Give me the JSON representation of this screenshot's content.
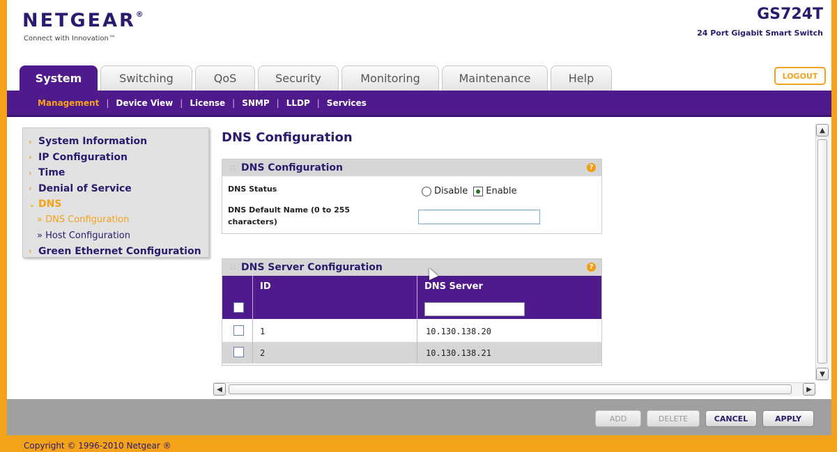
{
  "header": {
    "logo": "NETGEAR",
    "registered": "®",
    "tagline": "Connect with Innovation™",
    "model": "GS724T",
    "model_subtitle": "24 Port Gigabit Smart Switch",
    "logout": "LOGOUT"
  },
  "tabs": [
    {
      "label": "System",
      "active": true
    },
    {
      "label": "Switching"
    },
    {
      "label": "QoS"
    },
    {
      "label": "Security"
    },
    {
      "label": "Monitoring"
    },
    {
      "label": "Maintenance"
    },
    {
      "label": "Help"
    }
  ],
  "subnav": [
    {
      "label": "Management",
      "active": true
    },
    {
      "label": "Device View"
    },
    {
      "label": "License"
    },
    {
      "label": "SNMP"
    },
    {
      "label": "LLDP"
    },
    {
      "label": "Services"
    }
  ],
  "sidebar": {
    "items": [
      {
        "label": "System Information"
      },
      {
        "label": "IP Configuration"
      },
      {
        "label": "Time"
      },
      {
        "label": "Denial of Service"
      },
      {
        "label": "DNS",
        "open": true
      },
      {
        "label": "» DNS Configuration",
        "sub": true,
        "active": true
      },
      {
        "label": "» Host Configuration",
        "sub": true
      },
      {
        "label": "Green Ethernet Configuration"
      }
    ]
  },
  "main": {
    "title": "DNS Configuration",
    "dns_panel": {
      "title": "DNS Configuration",
      "status_label": "DNS Status",
      "disable_label": "Disable",
      "enable_label": "Enable",
      "selected": "Enable",
      "default_name_label_1": "DNS Default Name (0 to 255",
      "default_name_label_2": "characters)",
      "default_name_value": ""
    },
    "server_panel": {
      "title": "DNS Server Configuration",
      "columns": [
        "ID",
        "DNS Server"
      ],
      "rows": [
        {
          "id": "1",
          "server": "10.130.138.20"
        },
        {
          "id": "2",
          "server": "10.130.138.21"
        }
      ]
    }
  },
  "buttons": {
    "add": "ADD",
    "delete": "DELETE",
    "cancel": "CANCEL",
    "apply": "APPLY"
  },
  "footer": {
    "copyright": "Copyright © 1996-2010 Netgear ®"
  },
  "colors": {
    "brand_purple": "#4f1a8b",
    "accent_orange": "#f3a21a",
    "title_navy": "#2b1a6e"
  }
}
